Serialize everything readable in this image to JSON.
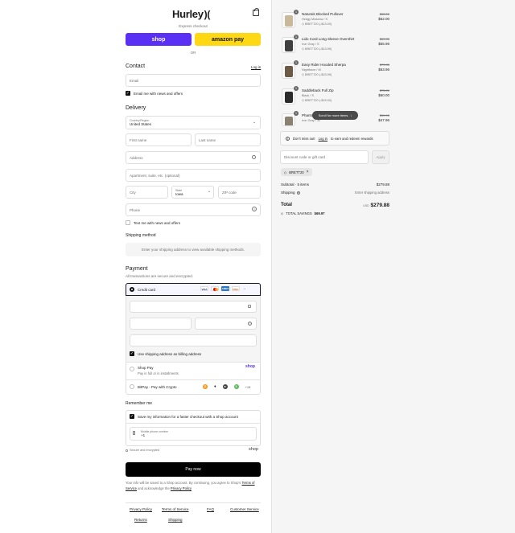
{
  "brand": {
    "logo_text": "Hurley",
    "logo_mark": ")("
  },
  "express": {
    "heading": "Express checkout",
    "shop_pay_label": "shop",
    "amazon_pay_label": "amazon pay",
    "or_label": "OR"
  },
  "contact": {
    "heading": "Contact",
    "login_link": "Log in",
    "email_placeholder": "Email",
    "email_optin_label": "Email me with news and offers"
  },
  "delivery": {
    "heading": "Delivery",
    "country_label": "Country/Region",
    "country_value": "United States",
    "first_name_placeholder": "First name",
    "last_name_placeholder": "Last name",
    "address_placeholder": "Address",
    "apartment_placeholder": "Apartment, suite, etc. (optional)",
    "city_placeholder": "City",
    "state_label": "State",
    "state_value": "Iowa",
    "zip_placeholder": "ZIP code",
    "phone_placeholder": "Phone",
    "sms_optin_label": "Text me with news and offers"
  },
  "shipping_method": {
    "heading": "Shipping method",
    "placeholder_text": "Enter your shipping address to view available shipping methods."
  },
  "payment": {
    "heading": "Payment",
    "subtext": "All transactions are secure and encrypted.",
    "credit_card_label": "Credit card",
    "card_logos": [
      "VISA",
      "MC",
      "AMEX",
      "DISC"
    ],
    "billing_same_label": "Use shipping address as billing address",
    "shop_pay_title": "Shop Pay",
    "shop_pay_subtitle": "Pay in full or in installments",
    "shop_pay_brand": "shop",
    "bitpay_label": "BitPay - Pay with Crypto",
    "bitpay_more": "+15"
  },
  "remember": {
    "heading": "Remember me",
    "save_label": "Save my information for a faster checkout with a Shop account",
    "mobile_label": "Mobile phone number",
    "mobile_value": "+1",
    "secure_text": "Secure and encrypted",
    "shop_brand": "shop"
  },
  "pay_now_label": "Pay now",
  "legal": {
    "line1": "Your info will be saved to a Shop account. By continuing, you agree to Shop's",
    "terms_link": "Terms of Service",
    "and_text": "and acknowledge the",
    "privacy_link": "Privacy Policy"
  },
  "footer": {
    "links": [
      "Privacy Policy",
      "Terms of Service",
      "FAQ",
      "Customer Service",
      "Returns",
      "Shipping"
    ]
  },
  "cart": {
    "items": [
      {
        "name": "Naturals Blocked Pullover",
        "variant": "Hedgy Meadow / S",
        "discount": "BRETT20 (-$13.00)",
        "original": "$65.00",
        "price": "$52.00",
        "qty": "1"
      },
      {
        "name": "Lido Cord Long Sleeve Overshirt",
        "variant": "Iron Gray / S",
        "discount": "BRETT20 (-$13.99)",
        "original": "$69.95",
        "price": "$55.96",
        "qty": "1"
      },
      {
        "name": "Easy Rider Hooded Sherpa",
        "variant": "Nightforce / M",
        "discount": "BRETT20 (-$15.99)",
        "original": "$79.95",
        "price": "$63.96",
        "qty": "1"
      },
      {
        "name": "Saddleback Full Zip",
        "variant": "Black / S",
        "discount": "BRETT20 (-$15.00)",
        "original": "$75.00",
        "price": "$60.00",
        "qty": "1"
      },
      {
        "name": "Phantom ... Boardshort",
        "variant": "Iron Gray / 32",
        "discount": "BRETT20 (-$11.99)",
        "original": "$59.95",
        "price": "$47.96",
        "qty": "1"
      }
    ],
    "scroll_hint": "Scroll for more items",
    "rewards_text_pre": "Don't miss out!",
    "rewards_link": "Log in",
    "rewards_text_post": "to earn and redeem rewards",
    "discount_placeholder": "Discount code or gift card",
    "apply_label": "Apply",
    "applied_code": "BRETT20",
    "subtotal_label": "Subtotal · 5 items",
    "subtotal_value": "$279.88",
    "shipping_label": "Shipping",
    "shipping_value": "Enter shipping address",
    "total_label": "Total",
    "currency": "USD",
    "total_value": "$279.88",
    "savings_label": "TOTAL SAVINGS",
    "savings_value": "$69.97"
  },
  "colors": {
    "shop_purple": "#5a31f4",
    "amazon_yellow": "#ffd814",
    "button_black": "#000000"
  }
}
